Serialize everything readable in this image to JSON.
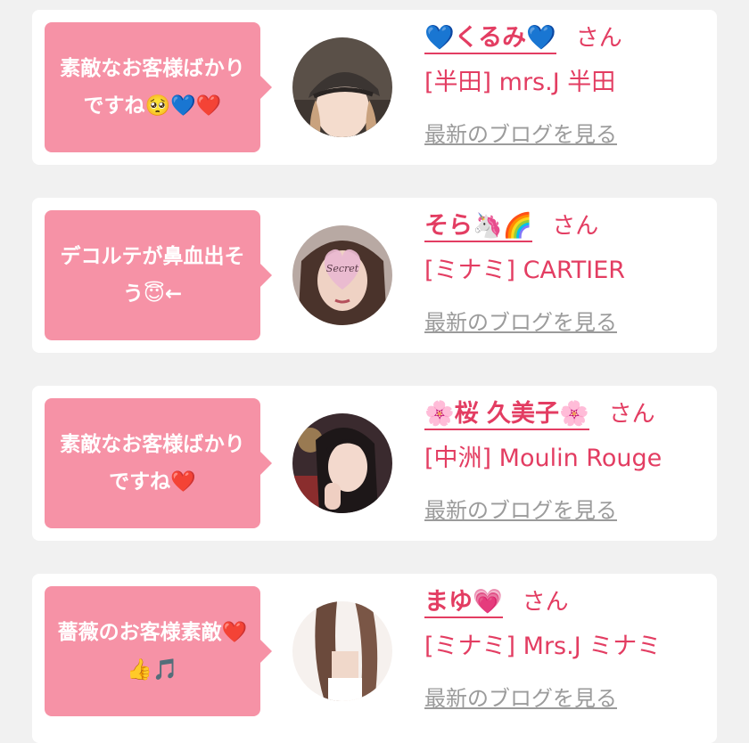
{
  "entries": [
    {
      "message": "素敵なお客様ばかりですね🥺💙❤️",
      "name": "💙くるみ💙",
      "honorific": "さん",
      "shop": "[半田] mrs.J 半田",
      "blog_link": "最新のブログを見る",
      "avatar_icon": "woman-with-cap-photo"
    },
    {
      "message": "デコルテが鼻血出そう😇←",
      "name": "そら🦄🌈",
      "honorific": "さん",
      "shop": "[ミナミ] CARTIER",
      "blog_link": "最新のブログを見る",
      "avatar_icon": "woman-with-secret-heart-photo"
    },
    {
      "message": "素敵なお客様ばかりですね❤️",
      "name": "🌸桜 久美子🌸",
      "honorific": "さん",
      "shop": "[中洲] Moulin Rouge",
      "blog_link": "最新のブログを見る",
      "avatar_icon": "woman-dark-hair-photo"
    },
    {
      "message": "薔薇のお客様素敵❤️👍🎵",
      "name": "まゆ💗",
      "honorific": "さん",
      "shop": "[ミナミ] Mrs.J ミナミ",
      "blog_link": "最新のブログを見る",
      "avatar_icon": "woman-long-hair-photo"
    }
  ],
  "colors": {
    "background": "#f1f1f1",
    "bubble": "#f692a6",
    "accent": "#e33d62",
    "link_gray": "#9b9b9b"
  }
}
